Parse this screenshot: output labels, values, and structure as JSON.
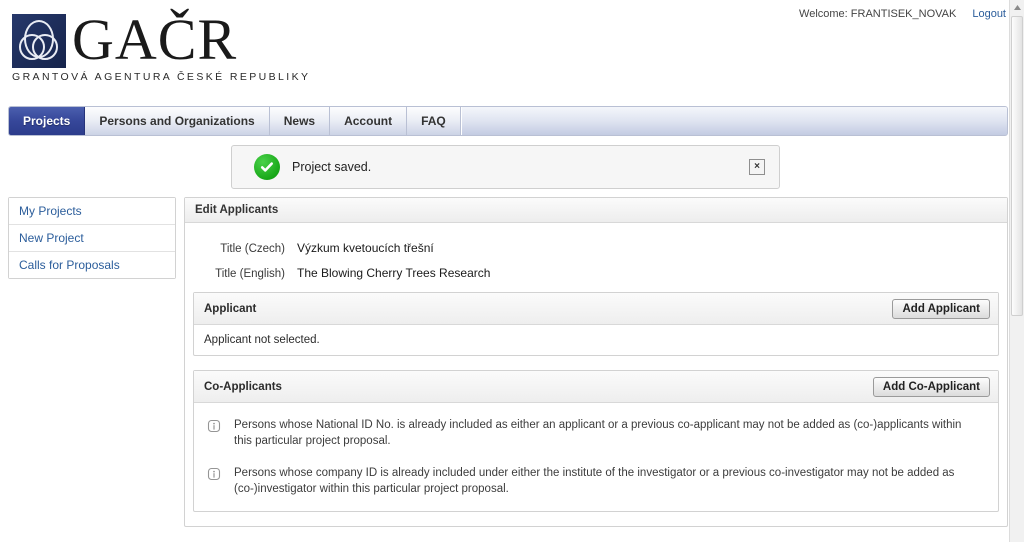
{
  "topbar": {
    "welcome": "Welcome: FRANTISEK_NOVAK",
    "logout_label": "Logout"
  },
  "logo": {
    "wordmark": "GAČR",
    "subtitle": "GRANTOVÁ AGENTURA ČESKÉ REPUBLIKY"
  },
  "tabs": [
    {
      "label": "Projects",
      "active": true
    },
    {
      "label": "Persons and Organizations",
      "active": false
    },
    {
      "label": "News",
      "active": false
    },
    {
      "label": "Account",
      "active": false
    },
    {
      "label": "FAQ",
      "active": false
    }
  ],
  "flash": {
    "message": "Project saved.",
    "icon": "check-circle-icon",
    "close_label": "×"
  },
  "sidebar": {
    "items": [
      {
        "label": "My Projects"
      },
      {
        "label": "New Project"
      },
      {
        "label": "Calls for Proposals"
      }
    ]
  },
  "main": {
    "panel_title": "Edit Applicants",
    "fields": [
      {
        "label": "Title (Czech)",
        "value": "Výzkum kvetoucích třešní"
      },
      {
        "label": "Title (English)",
        "value": "The Blowing Cherry Trees Research"
      }
    ],
    "applicant_section": {
      "title": "Applicant",
      "button_label": "Add Applicant",
      "body_text": "Applicant not selected."
    },
    "coapplicant_section": {
      "title": "Co-Applicants",
      "button_label": "Add Co-Applicant",
      "notes": [
        "Persons whose National ID No. is already included as either an applicant or a previous co-applicant may not be added as (co-)applicants within this particular project proposal.",
        "Persons whose company ID is already included under either the institute of the investigator or a previous co-investigator may not be added as (co-)investigator within this particular project proposal."
      ]
    }
  },
  "colors": {
    "active_tab": "#36479a",
    "link": "#2b5d9b",
    "success": "#18a818",
    "logo_navy": "#26386b"
  }
}
